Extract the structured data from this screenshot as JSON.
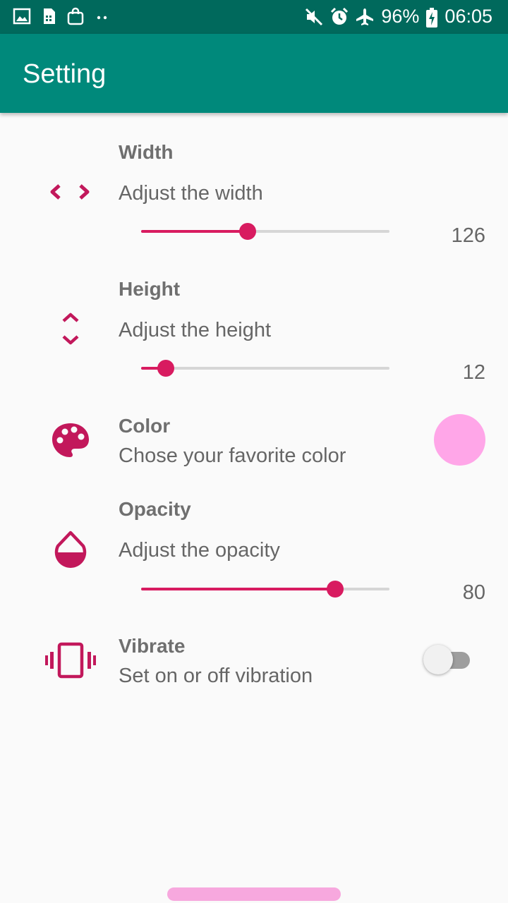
{
  "status_bar": {
    "battery": "96%",
    "time": "06:05",
    "left_icons": [
      "gallery-icon",
      "sim-icon",
      "shopping-bag-icon",
      "more-dots-icon"
    ],
    "right_icons": [
      "mute-icon",
      "alarm-icon",
      "airplane-mode-icon",
      "battery-charging-icon"
    ]
  },
  "app_bar": {
    "title": "Setting"
  },
  "accent_color": "#d81b60",
  "settings": {
    "width": {
      "title": "Width",
      "subtitle": "Adjust the width",
      "value": "126",
      "level": 0.43,
      "icon": "code-arrows-icon"
    },
    "height": {
      "title": "Height",
      "subtitle": "Adjust the height",
      "value": "12",
      "level": 0.1,
      "icon": "unfold-icon"
    },
    "color": {
      "title": "Color",
      "subtitle": "Chose your favorite color",
      "swatch": "#ffa6e8",
      "icon": "palette-icon"
    },
    "opacity": {
      "title": "Opacity",
      "subtitle": "Adjust the opacity",
      "value": "80",
      "level": 0.78,
      "icon": "opacity-icon"
    },
    "vibrate": {
      "title": "Vibrate",
      "subtitle": "Set on or off vibration",
      "enabled": false,
      "icon": "vibration-icon"
    }
  }
}
